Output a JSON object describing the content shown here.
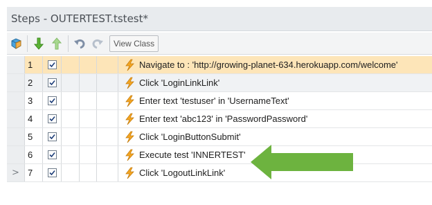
{
  "panel": {
    "title": "Steps - OUTERTEST.tstest*"
  },
  "toolbar": {
    "view_class_label": "View Class"
  },
  "rows": [
    {
      "num": "1",
      "indicator": "",
      "text": "Navigate to : 'http://growing-planet-634.herokuapp.com/welcome'",
      "checked": true
    },
    {
      "num": "2",
      "indicator": "",
      "text": "Click 'LoginLinkLink'",
      "checked": true
    },
    {
      "num": "3",
      "indicator": "",
      "text": "Enter text 'testuser' in 'UsernameText'",
      "checked": true
    },
    {
      "num": "4",
      "indicator": "",
      "text": "Enter text 'abc123' in 'PasswordPassword'",
      "checked": true
    },
    {
      "num": "5",
      "indicator": "",
      "text": "Click 'LoginButtonSubmit'",
      "checked": true
    },
    {
      "num": "6",
      "indicator": "",
      "text": "Execute test 'INNERTEST'",
      "checked": true
    },
    {
      "num": "7",
      "indicator": ">",
      "text": "Click 'LogoutLinkLink'",
      "checked": true
    }
  ],
  "colors": {
    "selected_row": "#fde5b8",
    "arrow": "#6db33f"
  }
}
